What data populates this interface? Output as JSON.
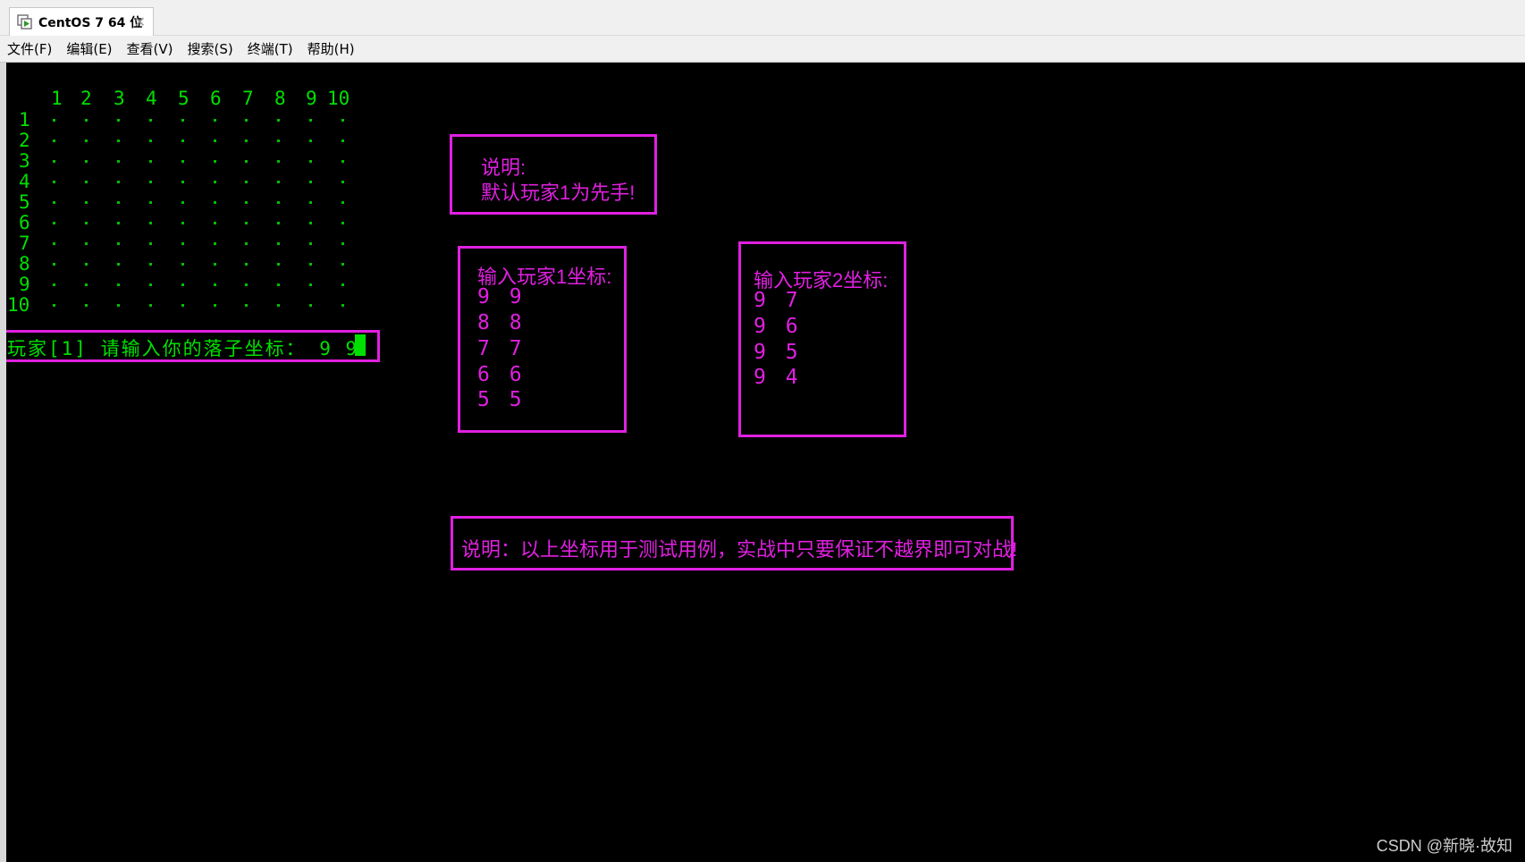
{
  "window": {
    "tab_title": "CentOS 7 64 位"
  },
  "menu": [
    "文件(F)",
    "编辑(E)",
    "查看(V)",
    "搜索(S)",
    "终端(T)",
    "帮助(H)"
  ],
  "board": {
    "col_labels": [
      "1",
      "2",
      "3",
      "4",
      "5",
      "6",
      "7",
      "8",
      "9",
      "10"
    ],
    "row_labels": [
      "1",
      "2",
      "3",
      "4",
      "5",
      "6",
      "7",
      "8",
      "9",
      "10"
    ],
    "cell_char": "."
  },
  "prompt": {
    "text": "玩家[1] 请输入你的落子坐标： 9 9"
  },
  "note1": {
    "title": "说明:",
    "body": "默认玩家1为先手!"
  },
  "player1": {
    "title": "输入玩家1坐标:",
    "coords": [
      "9 9",
      "8 8",
      "7 7",
      "6 6",
      "5 5"
    ]
  },
  "player2": {
    "title": "输入玩家2坐标:",
    "coords": [
      "9 7",
      "9 6",
      "9 5",
      "9 4"
    ]
  },
  "note2": {
    "text": "说明：以上坐标用于测试用例，实战中只要保证不越界即可对战!"
  },
  "watermark": "CSDN @新晓·故知",
  "colors": {
    "terminal_bg": "#000000",
    "terminal_fg": "#00e000",
    "annotation": "#e020e0"
  }
}
